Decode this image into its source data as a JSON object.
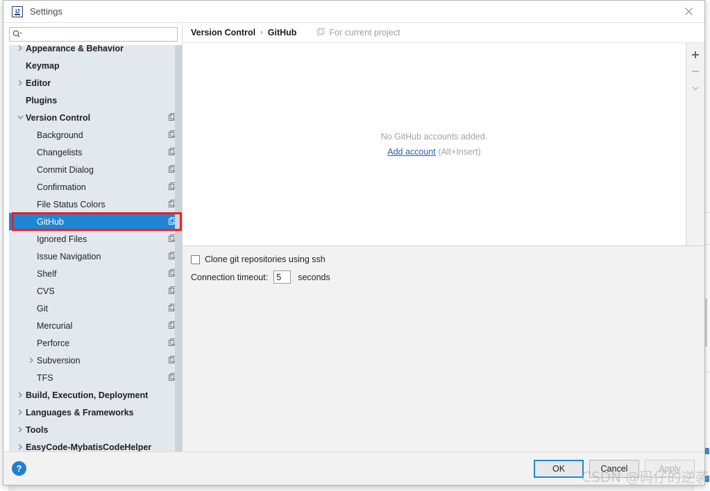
{
  "window": {
    "title": "Settings",
    "app_icon": "intellij-idea-icon",
    "close_icon": "close-icon"
  },
  "search": {
    "value": "",
    "placeholder": "",
    "icon": "search-icon"
  },
  "sidebar": {
    "scrollbar": "vertical-scrollbar",
    "items": [
      {
        "label": "Appearance & Behavior",
        "level": 1,
        "arrow": "chevron-right",
        "bold": true,
        "project_icon": false,
        "selected": false
      },
      {
        "label": "Keymap",
        "level": 1,
        "arrow": "none",
        "bold": true,
        "project_icon": false,
        "selected": false
      },
      {
        "label": "Editor",
        "level": 1,
        "arrow": "chevron-right",
        "bold": true,
        "project_icon": false,
        "selected": false
      },
      {
        "label": "Plugins",
        "level": 1,
        "arrow": "none",
        "bold": true,
        "project_icon": false,
        "selected": false
      },
      {
        "label": "Version Control",
        "level": 1,
        "arrow": "chevron-down",
        "bold": true,
        "project_icon": true,
        "selected": false
      },
      {
        "label": "Background",
        "level": 2,
        "arrow": "none",
        "bold": false,
        "project_icon": true,
        "selected": false
      },
      {
        "label": "Changelists",
        "level": 2,
        "arrow": "none",
        "bold": false,
        "project_icon": true,
        "selected": false
      },
      {
        "label": "Commit Dialog",
        "level": 2,
        "arrow": "none",
        "bold": false,
        "project_icon": true,
        "selected": false
      },
      {
        "label": "Confirmation",
        "level": 2,
        "arrow": "none",
        "bold": false,
        "project_icon": true,
        "selected": false
      },
      {
        "label": "File Status Colors",
        "level": 2,
        "arrow": "none",
        "bold": false,
        "project_icon": true,
        "selected": false
      },
      {
        "label": "GitHub",
        "level": 2,
        "arrow": "none",
        "bold": false,
        "project_icon": true,
        "selected": true
      },
      {
        "label": "Ignored Files",
        "level": 2,
        "arrow": "none",
        "bold": false,
        "project_icon": true,
        "selected": false
      },
      {
        "label": "Issue Navigation",
        "level": 2,
        "arrow": "none",
        "bold": false,
        "project_icon": true,
        "selected": false
      },
      {
        "label": "Shelf",
        "level": 2,
        "arrow": "none",
        "bold": false,
        "project_icon": true,
        "selected": false
      },
      {
        "label": "CVS",
        "level": 2,
        "arrow": "none",
        "bold": false,
        "project_icon": true,
        "selected": false
      },
      {
        "label": "Git",
        "level": 2,
        "arrow": "none",
        "bold": false,
        "project_icon": true,
        "selected": false
      },
      {
        "label": "Mercurial",
        "level": 2,
        "arrow": "none",
        "bold": false,
        "project_icon": true,
        "selected": false
      },
      {
        "label": "Perforce",
        "level": 2,
        "arrow": "none",
        "bold": false,
        "project_icon": true,
        "selected": false
      },
      {
        "label": "Subversion",
        "level": 2,
        "arrow": "chevron-right",
        "bold": false,
        "project_icon": true,
        "selected": false
      },
      {
        "label": "TFS",
        "level": 2,
        "arrow": "none",
        "bold": false,
        "project_icon": true,
        "selected": false
      },
      {
        "label": "Build, Execution, Deployment",
        "level": 1,
        "arrow": "chevron-right",
        "bold": true,
        "project_icon": false,
        "selected": false
      },
      {
        "label": "Languages & Frameworks",
        "level": 1,
        "arrow": "chevron-right",
        "bold": true,
        "project_icon": false,
        "selected": false
      },
      {
        "label": "Tools",
        "level": 1,
        "arrow": "chevron-right",
        "bold": true,
        "project_icon": false,
        "selected": false
      },
      {
        "label": "EasyCode-MybatisCodeHelper",
        "level": 1,
        "arrow": "chevron-right",
        "bold": true,
        "project_icon": false,
        "selected": false
      }
    ]
  },
  "breadcrumb": {
    "parent": "Version Control",
    "separator": "›",
    "current": "GitHub",
    "scope_icon": "project-scope-icon",
    "scope_note": "For current project"
  },
  "accounts": {
    "empty_message": "No GitHub accounts added.",
    "add_link": "Add account",
    "add_shortcut": "(Alt+Insert)",
    "toolbar": [
      {
        "icon": "plus-icon",
        "label": "+",
        "enabled": true
      },
      {
        "icon": "minus-icon",
        "label": "−",
        "enabled": false
      },
      {
        "icon": "chevron-down-icon",
        "label": "∨",
        "enabled": false
      }
    ]
  },
  "options": {
    "clone_ssh_label": "Clone git repositories using ssh",
    "clone_ssh_checked": false,
    "timeout_label": "Connection timeout:",
    "timeout_value": "5",
    "timeout_unit": "seconds"
  },
  "footer": {
    "help_label": "?",
    "ok_label": "OK",
    "cancel_label": "Cancel",
    "apply_label": "Apply"
  },
  "watermark": {
    "text": "CSDN @码仔的逆袭"
  },
  "colors": {
    "selection_blue": "#1f86d4",
    "annotation_red": "#fc1b1b",
    "link_blue": "#2a5db0",
    "sidebar_bg": "#e3e8ee",
    "dialog_bg": "#f2f2f2"
  }
}
